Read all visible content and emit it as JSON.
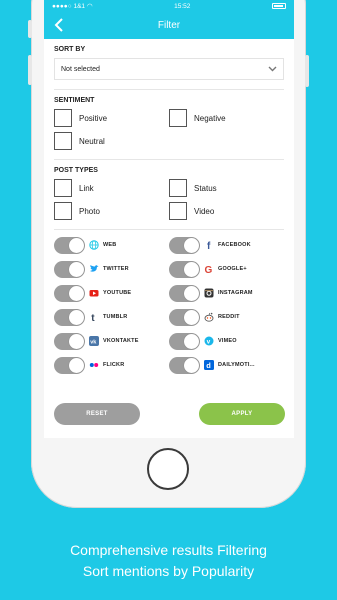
{
  "status": {
    "carrier": "1&1",
    "time": "15:52"
  },
  "header": {
    "title": "Filter"
  },
  "sort": {
    "label": "SORT BY",
    "value": "Not selected"
  },
  "sentiment": {
    "label": "SENTIMENT",
    "items": [
      {
        "label": "Positive"
      },
      {
        "label": "Negative"
      },
      {
        "label": "Neutral"
      }
    ]
  },
  "post_types": {
    "label": "POST TYPES",
    "items": [
      {
        "label": "Link"
      },
      {
        "label": "Status"
      },
      {
        "label": "Photo"
      },
      {
        "label": "Video"
      }
    ]
  },
  "sources": [
    {
      "label": "WEB",
      "icon": "globe-icon",
      "color": "#1ec9e6"
    },
    {
      "label": "FACEBOOK",
      "icon": "facebook-icon",
      "color": "#3b5998"
    },
    {
      "label": "TWITTER",
      "icon": "twitter-icon",
      "color": "#1da1f2"
    },
    {
      "label": "GOOGLE+",
      "icon": "google-icon",
      "color": "#db4437"
    },
    {
      "label": "YOUTUBE",
      "icon": "youtube-icon",
      "color": "#e62117"
    },
    {
      "label": "INSTAGRAM",
      "icon": "instagram-icon",
      "color": "#333333"
    },
    {
      "label": "TUMBLR",
      "icon": "tumblr-icon",
      "color": "#35465c"
    },
    {
      "label": "REDDIT",
      "icon": "reddit-icon",
      "color": "#ff4500"
    },
    {
      "label": "VKONTAKTE",
      "icon": "vk-icon",
      "color": "#4a76a8"
    },
    {
      "label": "VIMEO",
      "icon": "vimeo-icon",
      "color": "#1ab7ea"
    },
    {
      "label": "FLICKR",
      "icon": "flickr-icon",
      "color": "#0063dc"
    },
    {
      "label": "DAILYMOTI...",
      "icon": "dailymotion-icon",
      "color": "#0066dc"
    }
  ],
  "buttons": {
    "reset": "RESET",
    "apply": "APPLY"
  },
  "colors": {
    "accent": "#1ec9e6",
    "apply": "#8bc34a",
    "reset": "#9e9e9e"
  },
  "caption": {
    "line1": "Comprehensive results Filtering",
    "line2": "Sort mentions by Popularity"
  }
}
